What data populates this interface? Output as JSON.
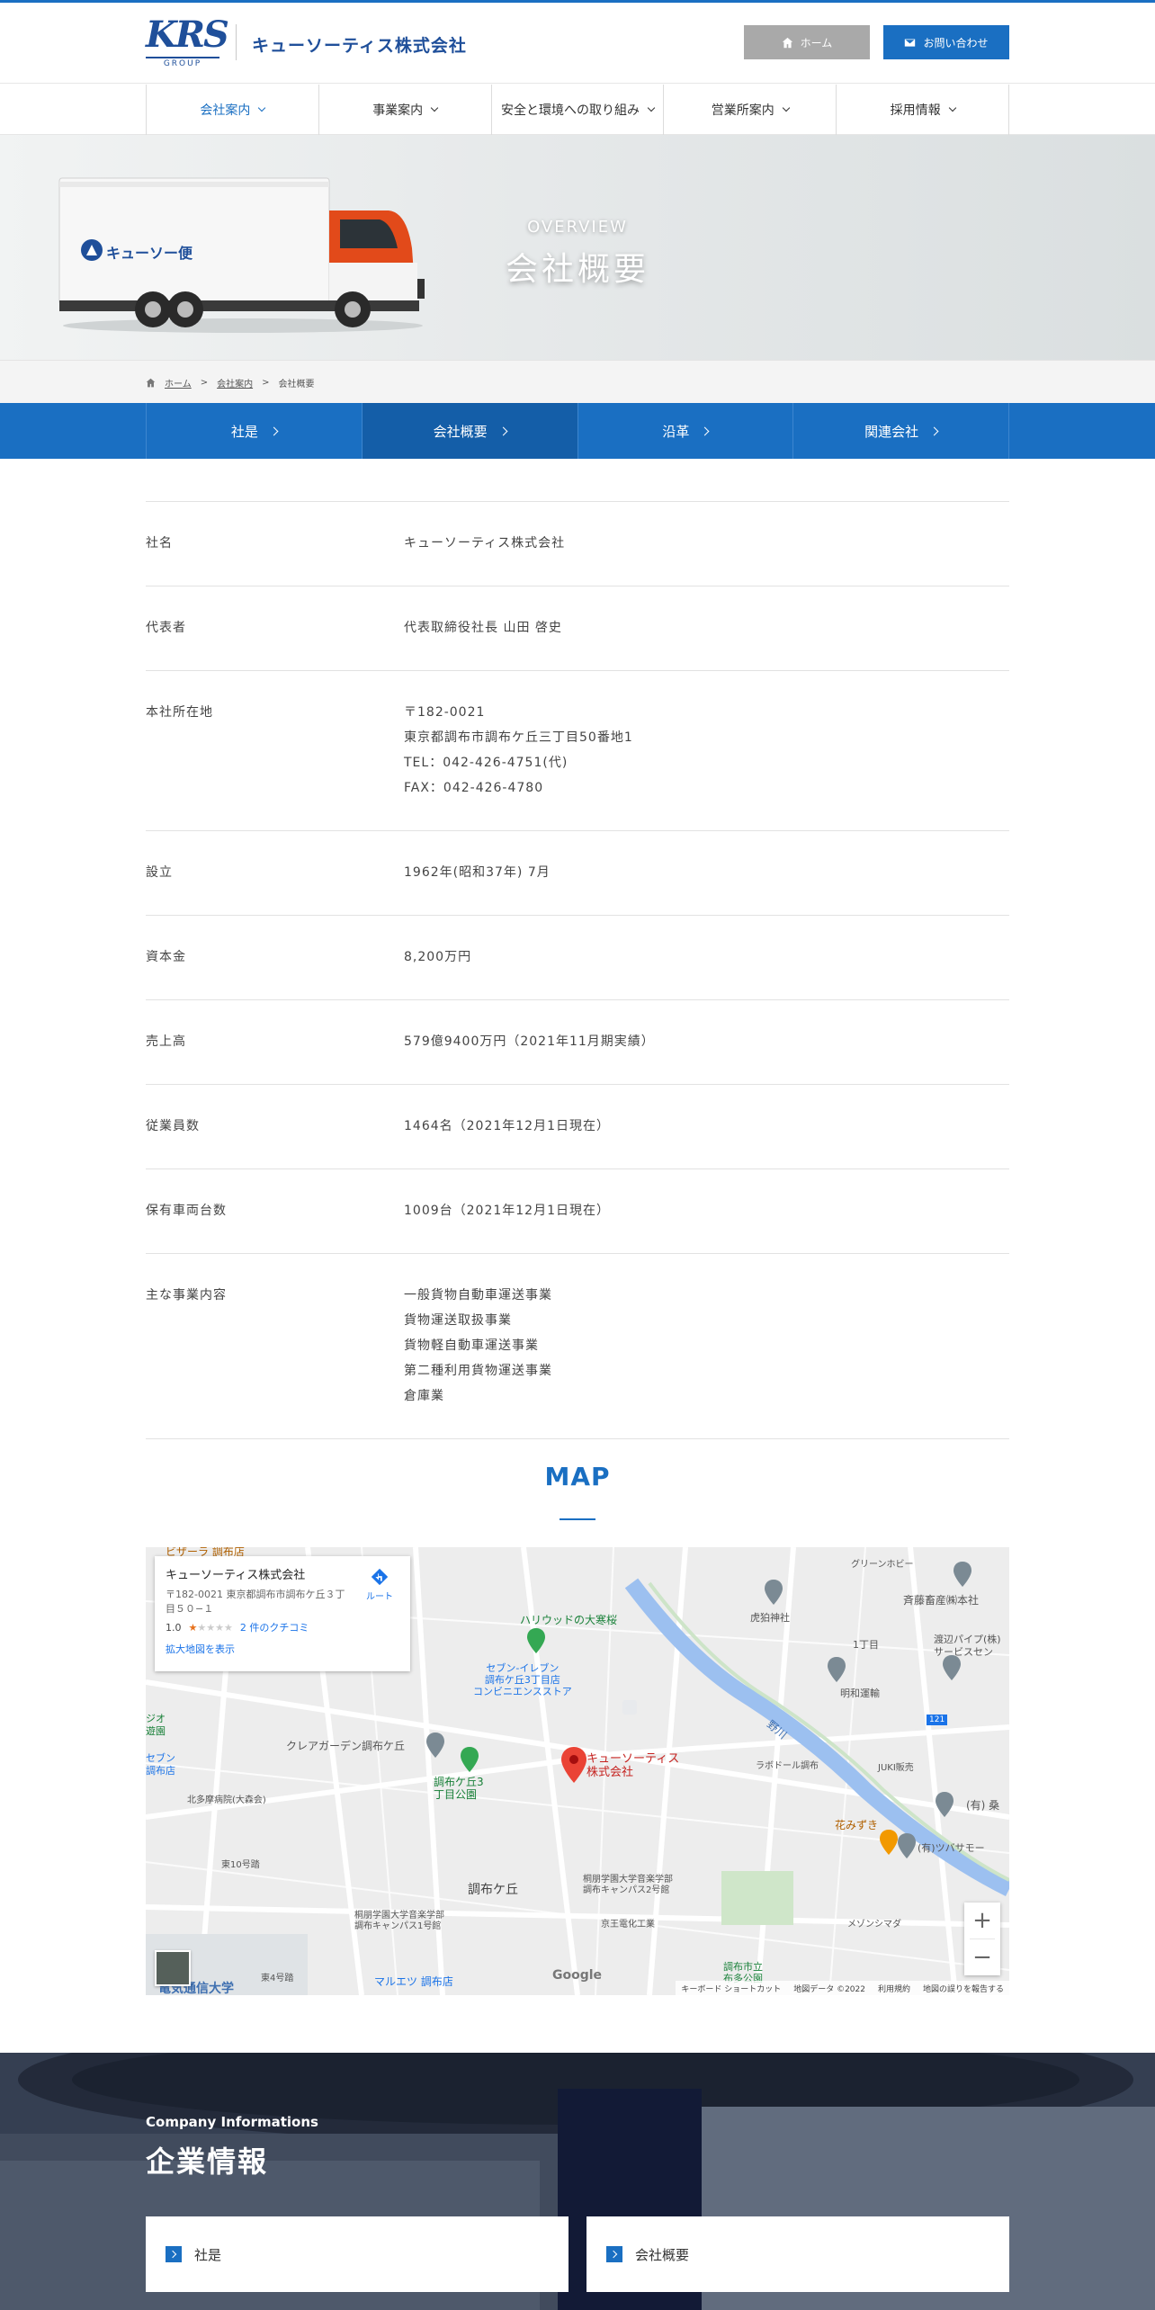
{
  "header": {
    "logo_text": "KRS",
    "logo_group": "GROUP",
    "company_name": "キューソーティス株式会社",
    "home_label": "ホーム",
    "contact_label": "お問い合わせ",
    "accent_color": "#1a6fc2"
  },
  "gnav": {
    "items": [
      {
        "label": "会社案内"
      },
      {
        "label": "事業案内"
      },
      {
        "label": "安全と環境への取り組み"
      },
      {
        "label": "営業所案内"
      },
      {
        "label": "採用情報"
      }
    ]
  },
  "hero": {
    "subtitle": "OVERVIEW",
    "title": "会社概要",
    "truck_brand": "キューソー便"
  },
  "breadcrumb": {
    "home": "ホーム",
    "sep": ">",
    "parent": "会社案内",
    "current": "会社概要"
  },
  "subnav": {
    "items": [
      {
        "label": "社是"
      },
      {
        "label": "会社概要"
      },
      {
        "label": "沿革"
      },
      {
        "label": "関連会社"
      }
    ]
  },
  "info": {
    "rows": [
      {
        "label": "社名",
        "lines": [
          "キューソーティス株式会社"
        ]
      },
      {
        "label": "代表者",
        "lines": [
          "代表取締役社長 山田 啓史"
        ]
      },
      {
        "label": "本社所在地",
        "lines": [
          "〒182-0021",
          "東京都調布市調布ケ丘三丁目50番地1",
          "TEL：042-426-4751(代)",
          "FAX：042-426-4780"
        ]
      },
      {
        "label": "設立",
        "lines": [
          "1962年(昭和37年) 7月"
        ]
      },
      {
        "label": "資本金",
        "lines": [
          "8,200万円"
        ]
      },
      {
        "label": "売上高",
        "lines": [
          "579億9400万円（2021年11月期実績）"
        ]
      },
      {
        "label": "従業員数",
        "lines": [
          "1464名（2021年12月1日現在）"
        ]
      },
      {
        "label": "保有車両台数",
        "lines": [
          "1009台（2021年12月1日現在）"
        ]
      },
      {
        "label": "主な事業内容",
        "lines": [
          "一般貨物自動車運送事業",
          "貨物運送取扱事業",
          "貨物軽自動車運送事業",
          "第二種利用貨物運送事業",
          "倉庫業"
        ]
      }
    ]
  },
  "map": {
    "title": "MAP",
    "card": {
      "name": "キューソーティス株式会社",
      "address": "〒182-0021 東京都調布市調布ケ丘３丁目５０−１",
      "rating": "1.0",
      "stars_filled": 1,
      "stars_total": 5,
      "reviews": "2 件のクチコミ",
      "enlarge": "拡大地図を表示",
      "route": "ルート"
    },
    "labels": {
      "marker": "キューソーティス\n株式会社",
      "gyoza": "ビザーラ 調布店",
      "green_hobby": "グリーンホビー",
      "saito": "斉藤畜産㈱本社",
      "torahaku": "虎狛神社",
      "watanabe": "渡辺パイプ(株)\nサービスセン",
      "hollywood": "ハリウッドの大寒桜",
      "seven": "セブン-イレブン\n調布ケ丘3丁目店\nコンビニエンスストア",
      "1chome": "1丁目",
      "meiji": "明和運輸",
      "river": "野川",
      "clear": "クレアガーデン調布ケ丘",
      "park": "調布ケ丘3\n丁目公園",
      "labo": "ラボドール調布",
      "juki": "JUKI販売",
      "yuukuwa": "(有) 桑",
      "hanamizuki": "花みずき",
      "kokko": "(有)ツバサモー",
      "hokuto": "北多摩病院(大森会)",
      "seven_left": "セブン\n調布店",
      "shinjo": "ジオ\n遊園",
      "higashi10": "東10号踏",
      "chofugaoka": "調布ケ丘",
      "toho_music2": "桐朋学園大学音楽学部\n調布キャンパス2号館",
      "keio": "京王電化工業",
      "toho_music1": "桐朋学園大学音楽学部\n調布キャンパス1号館",
      "mezon": "メゾンシマダ",
      "higashi4": "東4号踏",
      "maruetsu": "マルエツ 調布店",
      "fujimi": "布多公園",
      "chofu_city_park": "調布市立\n布多公園",
      "denki": "電気通信大学",
      "road121": "121"
    },
    "footer": [
      "キーボード ショートカット",
      "地図データ ©2022",
      "利用規約",
      "地図の誤りを報告する"
    ],
    "google": "Google"
  },
  "company": {
    "subtitle": "Company Informations",
    "title": "企業情報",
    "cards": [
      {
        "label": "社是"
      },
      {
        "label": "会社概要"
      }
    ]
  }
}
